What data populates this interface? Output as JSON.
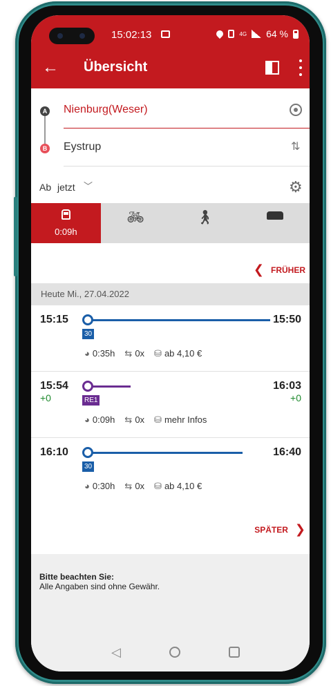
{
  "status_bar": {
    "time": "15:02:13",
    "network": "4G",
    "battery": "64 %"
  },
  "app_bar": {
    "title": "Übersicht"
  },
  "search": {
    "from": "Nienburg(Weser)",
    "to": "Eystrup",
    "marker_a": "A",
    "marker_b": "B",
    "time_label": "Ab",
    "time_value": "jetzt"
  },
  "modes": [
    {
      "name": "train",
      "duration": "0:09h",
      "active": true
    },
    {
      "name": "bike"
    },
    {
      "name": "walk"
    },
    {
      "name": "car-park"
    }
  ],
  "pagination": {
    "earlier": "FRÜHER",
    "later": "SPÄTER"
  },
  "date_header": "Heute Mi., 27.04.2022",
  "connections": [
    {
      "dep": "15:15",
      "arr": "15:50",
      "line": "30",
      "line_color": "#1a5ea8",
      "duration": "0:35h",
      "changes": "0x",
      "price": "ab 4,10 €"
    },
    {
      "dep": "15:54",
      "arr": "16:03",
      "dep_delay": "+0",
      "arr_delay": "+0",
      "line": "RE1",
      "line_color": "#6a2c91",
      "duration": "0:09h",
      "changes": "0x",
      "price": "mehr Infos"
    },
    {
      "dep": "16:10",
      "arr": "16:40",
      "line": "30",
      "line_color": "#1a5ea8",
      "duration": "0:30h",
      "changes": "0x",
      "price": "ab 4,10 €"
    }
  ],
  "notice": {
    "title": "Bitte beachten Sie:",
    "text": "Alle Angaben sind ohne Gewähr."
  },
  "colors": {
    "brand": "#c31a1f",
    "on_time": "#1f8a2e"
  }
}
